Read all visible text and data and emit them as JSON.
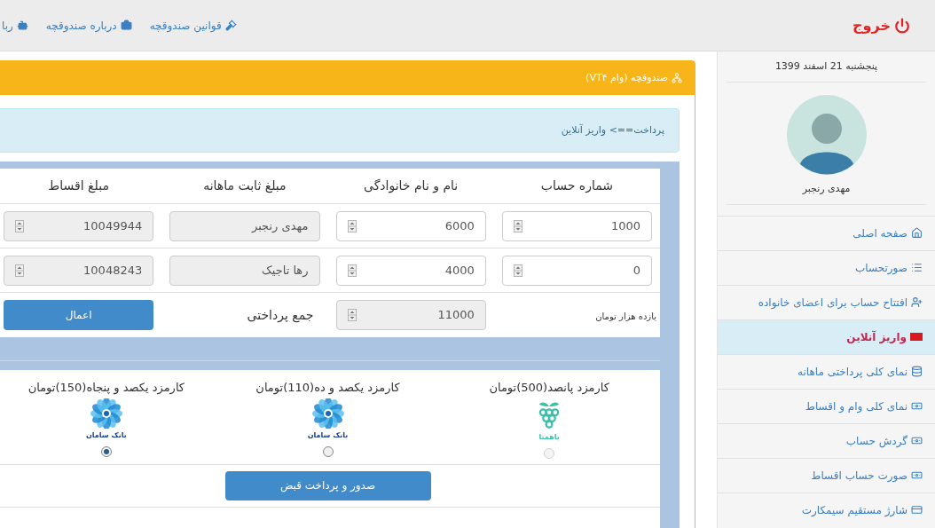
{
  "navbar": {
    "logout": "خروج",
    "links": [
      {
        "label": "قوانین صندوقچه"
      },
      {
        "label": "درباره صندوقچه"
      },
      {
        "label": "ربا"
      }
    ]
  },
  "sidebar": {
    "date": "پنجشنبه 21 اسفند 1399",
    "user_name": "مهدی رنجبر",
    "items": [
      {
        "label": "صفحه اصلی",
        "selected": false
      },
      {
        "label": "صورتحساب",
        "selected": false
      },
      {
        "label": "افتتاح حساب برای اعضای خانواده",
        "selected": false
      },
      {
        "label": "واریز آنلاین",
        "selected": true
      },
      {
        "label": "نمای کلی پرداختی ماهانه",
        "selected": false
      },
      {
        "label": "نمای کلی وام و اقساط",
        "selected": false
      },
      {
        "label": "گردش حساب",
        "selected": false
      },
      {
        "label": "صورت حساب اقساط",
        "selected": false
      },
      {
        "label": "شارژ مستقیم سیمکارت",
        "selected": false
      }
    ]
  },
  "panel": {
    "title": "صندوقچه (وام VT۴)",
    "breadcrumb": "پرداخت==> واریز آنلاین"
  },
  "table": {
    "columns": [
      "شماره حساب",
      "نام و نام خانوادگی",
      "مبلغ ثابت ماهانه",
      "مبلغ اقساط"
    ],
    "rows": [
      {
        "cells": [
          {
            "kind": "number",
            "value": "1000",
            "disabled": false
          },
          {
            "kind": "number",
            "value": "6000",
            "disabled": false
          },
          {
            "kind": "text",
            "value": "مهدی رنجبر",
            "disabled": true
          },
          {
            "kind": "number",
            "value": "10049944",
            "disabled": true
          }
        ]
      },
      {
        "cells": [
          {
            "kind": "number",
            "value": "0",
            "disabled": false
          },
          {
            "kind": "number",
            "value": "4000",
            "disabled": false
          },
          {
            "kind": "text",
            "value": "رها تاجیک",
            "disabled": true
          },
          {
            "kind": "number",
            "value": "10048243",
            "disabled": true
          }
        ]
      }
    ],
    "total": {
      "words": "یازده هزار تومان",
      "value": "11000",
      "disabled": true,
      "label": "جمع پرداختی",
      "button": "اعمال"
    }
  },
  "gateways": [
    {
      "label": "کارمزد پانصد(500)تومان",
      "kind": "bahamta",
      "logo_text": "باهمتا",
      "selected": false,
      "disabled": true
    },
    {
      "label": "کارمزد یکصد و ده(110)تومان",
      "kind": "saman",
      "logo_text": "بانک سامان",
      "selected": false,
      "disabled": false
    },
    {
      "label": "کارمزد یکصد و پنجاه(150)تومان",
      "kind": "saman",
      "logo_text": "بانک سامان",
      "selected": true,
      "disabled": false
    }
  ],
  "submit_button": "صدور و پرداخت قبض"
}
